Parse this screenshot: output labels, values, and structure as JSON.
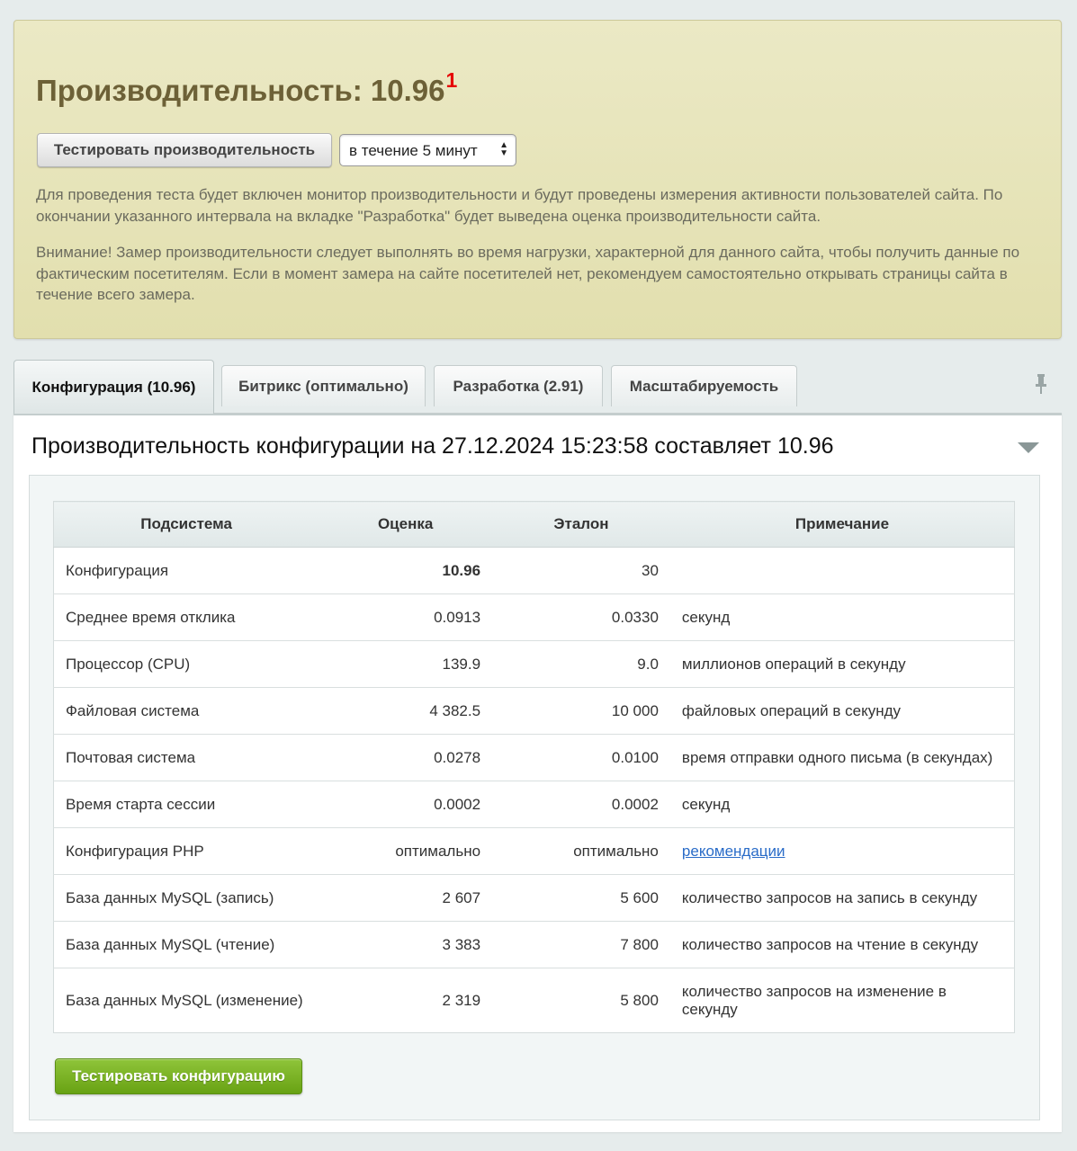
{
  "performance": {
    "title": "Производительность: 10.96",
    "footnote": "1",
    "test_button": "Тестировать производительность",
    "duration_select": "в течение 5 минут",
    "description": "Для проведения теста будет включен монитор производительности и будут проведены измерения активности пользователей сайта. По окончании указанного интервала на вкладке \"Разработка\" будет выведена оценка производительности сайта.",
    "warning": "Внимание! Замер производительности следует выполнять во время нагрузки, характерной для данного сайта, чтобы получить данные по фактическим посетителям. Если в момент замера на сайте посетителей нет, рекомендуем самостоятельно открывать страницы сайта в течение всего замера."
  },
  "tabs": [
    {
      "label": "Конфигурация (10.96)",
      "active": true
    },
    {
      "label": "Битрикс (оптимально)",
      "active": false
    },
    {
      "label": "Разработка (2.91)",
      "active": false
    },
    {
      "label": "Масштабируемость",
      "active": false
    }
  ],
  "content": {
    "title": "Производительность конфигурации на 27.12.2024 15:23:58 составляет 10.96",
    "table": {
      "headers": [
        "Подсистема",
        "Оценка",
        "Эталон",
        "Примечание"
      ],
      "rows": [
        {
          "subsystem": "Конфигурация",
          "score": "10.96",
          "reference": "30",
          "note": ""
        },
        {
          "subsystem": "Среднее время отклика",
          "score": "0.0913",
          "reference": "0.0330",
          "note": "секунд"
        },
        {
          "subsystem": "Процессор (CPU)",
          "score": "139.9",
          "reference": "9.0",
          "note": "миллионов операций в секунду"
        },
        {
          "subsystem": "Файловая система",
          "score": "4 382.5",
          "reference": "10 000",
          "note": "файловых операций в секунду"
        },
        {
          "subsystem": "Почтовая система",
          "score": "0.0278",
          "reference": "0.0100",
          "note": "время отправки одного письма (в секундах)"
        },
        {
          "subsystem": "Время старта сессии",
          "score": "0.0002",
          "reference": "0.0002",
          "note": "секунд"
        },
        {
          "subsystem": "Конфигурация PHP",
          "score": "оптимально",
          "reference": "оптимально",
          "note": "рекомендации"
        },
        {
          "subsystem": "База данных MySQL (запись)",
          "score": "2 607",
          "reference": "5 600",
          "note": "количество запросов на запись в секунду"
        },
        {
          "subsystem": "База данных MySQL (чтение)",
          "score": "3 383",
          "reference": "7 800",
          "note": "количество запросов на чтение в секунду"
        },
        {
          "subsystem": "База данных MySQL (изменение)",
          "score": "2 319",
          "reference": "5 800",
          "note": "количество запросов на изменение в секунду"
        }
      ]
    },
    "test_config_button": "Тестировать конфигурацию"
  },
  "icons": {
    "pin": "pin-icon",
    "collapse": "chevron-down-icon"
  },
  "colors": {
    "accent_green": "#6fa81b",
    "title_brown": "#6d6137",
    "footnote_red": "#e50000",
    "link_blue": "#2a6cc8"
  }
}
